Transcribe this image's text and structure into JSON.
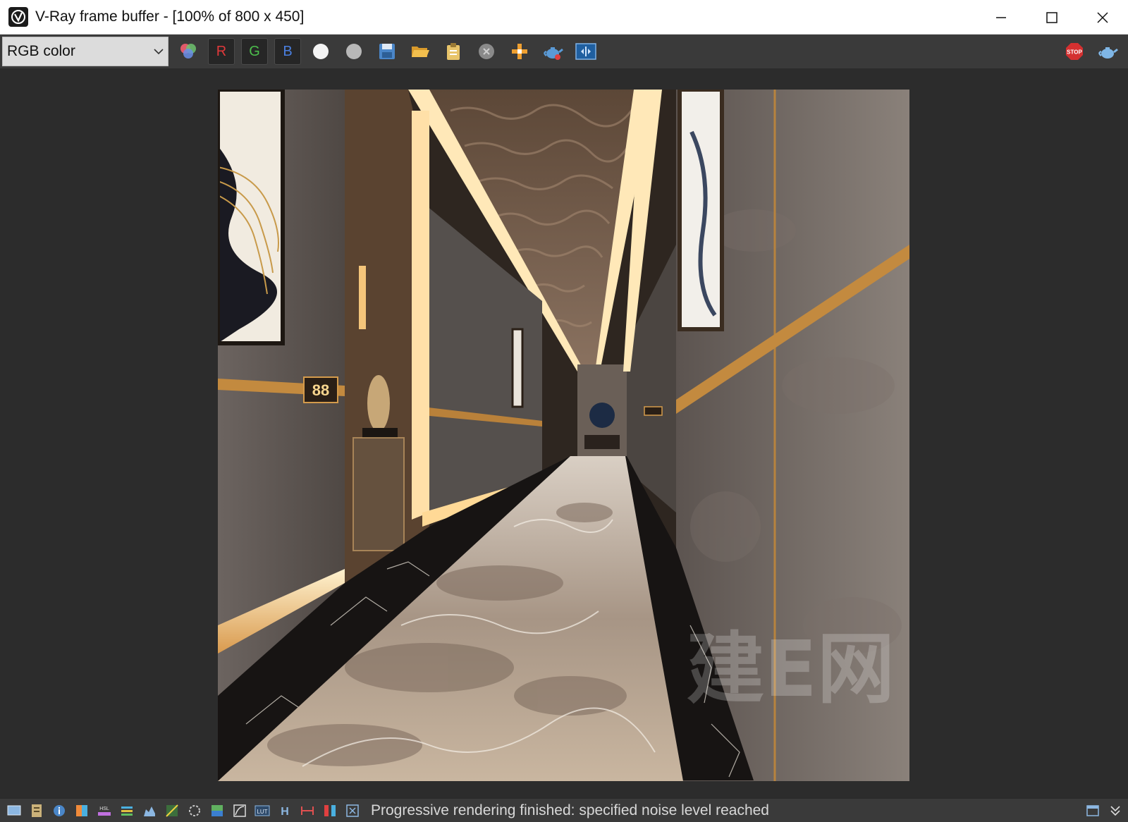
{
  "window": {
    "title": "V-Ray frame buffer - [100% of 800 x 450]"
  },
  "toolbar": {
    "channel_select_value": "RGB color",
    "red_label": "R",
    "green_label": "G",
    "blue_label": "B"
  },
  "icons": {
    "app": "vray-logo-icon",
    "minimize": "minimize-icon",
    "maximize": "maximize-icon",
    "close": "close-icon",
    "color_channels": "color-channels-icon",
    "white_swatch": "white-circle-icon",
    "gray_swatch": "gray-circle-icon",
    "save": "save-icon",
    "open": "folder-open-icon",
    "clipboard": "clipboard-icon",
    "clear": "clear-icon",
    "region": "region-render-icon",
    "render_teapot": "teapot-icon",
    "compare": "ab-compare-icon",
    "stop": "stop-icon",
    "render_right": "render-teapot-icon"
  },
  "render": {
    "watermark": "建E网",
    "room_sign": "88"
  },
  "status": {
    "message": "Progressive rendering finished: specified noise level reached",
    "icons": [
      "display-icon",
      "history-icon",
      "info-icon",
      "color-correction-icon",
      "hsl-icon",
      "curves-icon",
      "levels-icon",
      "exposure-icon",
      "white-balance-icon",
      "background-icon",
      "lens-effects-icon",
      "lut-icon",
      "H",
      "ocio-icon",
      "compare-icon",
      "settings-icon"
    ]
  },
  "colors": {
    "titlebar_bg": "#ffffff",
    "toolbar_bg": "#3a3a3a",
    "viewport_bg": "#2c2c2c",
    "status_text": "#d8d8d8",
    "red": "#e0393b",
    "green": "#4cbf4c",
    "blue": "#4a7fe0"
  }
}
